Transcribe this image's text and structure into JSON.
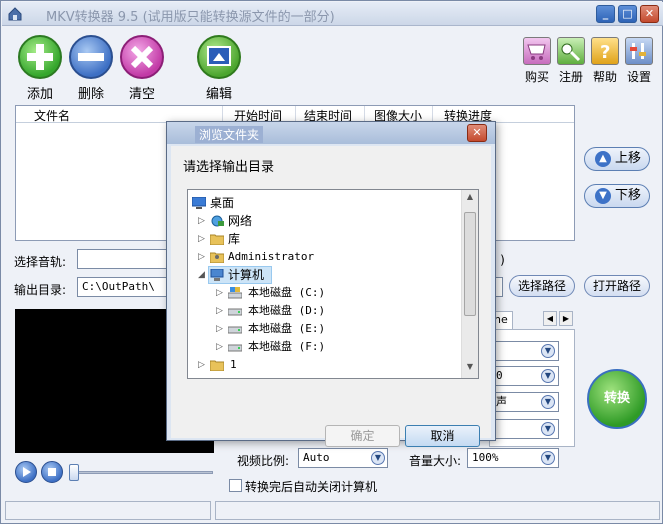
{
  "window": {
    "title": "MKV转换器 9.5 (试用版只能转换源文件的一部分)"
  },
  "toolbar": [
    {
      "label": "添加",
      "icon": "add-icon"
    },
    {
      "label": "删除",
      "icon": "remove-icon"
    },
    {
      "label": "清空",
      "icon": "clear-icon"
    },
    {
      "label": "编辑",
      "icon": "edit-icon"
    }
  ],
  "top_right": [
    {
      "label": "购买",
      "icon": "cart-icon"
    },
    {
      "label": "注册",
      "icon": "key-icon"
    },
    {
      "label": "帮助",
      "icon": "help-icon"
    },
    {
      "label": "设置",
      "icon": "settings-icon"
    }
  ],
  "file_list": {
    "columns": [
      "文件名",
      "开始时间",
      "结束时间",
      "图像大小",
      "转换进度"
    ]
  },
  "side_buttons": {
    "move_up": "上移",
    "move_down": "下移"
  },
  "audio": {
    "label": "选择音轨:",
    "value": ""
  },
  "output": {
    "label": "输出目录:",
    "value": "C:\\OutPath\\",
    "choose_label": "选择路径",
    "open_label": "打开路径"
  },
  "right_tabs": {
    "tab_partial": "ne",
    "partial_suffix": "o )",
    "combo_partial_1": "0",
    "combo_partial_2": "声"
  },
  "settings": {
    "aspect_label": "视频比例:",
    "aspect_value": "Auto",
    "volume_label": "音量大小:",
    "volume_value": "100%"
  },
  "shutdown_checkbox": {
    "label": "转换完后自动关闭计算机",
    "checked": false
  },
  "convert_button": "转换",
  "dialog": {
    "title": "浏览文件夹",
    "prompt": "请选择输出目录",
    "tree": [
      {
        "label": "桌面",
        "icon": "desktop-icon",
        "level": 0
      },
      {
        "label": "网络",
        "icon": "network-icon",
        "level": 1
      },
      {
        "label": "库",
        "icon": "library-icon",
        "level": 1
      },
      {
        "label": "Administrator",
        "icon": "user-folder-icon",
        "level": 1
      },
      {
        "label": "计算机",
        "icon": "computer-icon",
        "level": 1,
        "selected": true
      },
      {
        "label": "本地磁盘 (C:)",
        "icon": "system-drive-icon",
        "level": 2
      },
      {
        "label": "本地磁盘 (D:)",
        "icon": "drive-icon",
        "level": 2
      },
      {
        "label": "本地磁盘 (E:)",
        "icon": "drive-icon",
        "level": 2
      },
      {
        "label": "本地磁盘 (F:)",
        "icon": "drive-icon",
        "level": 2
      },
      {
        "label": "1",
        "icon": "folder-icon",
        "level": 1
      }
    ],
    "ok_label": "确定",
    "cancel_label": "取消"
  }
}
